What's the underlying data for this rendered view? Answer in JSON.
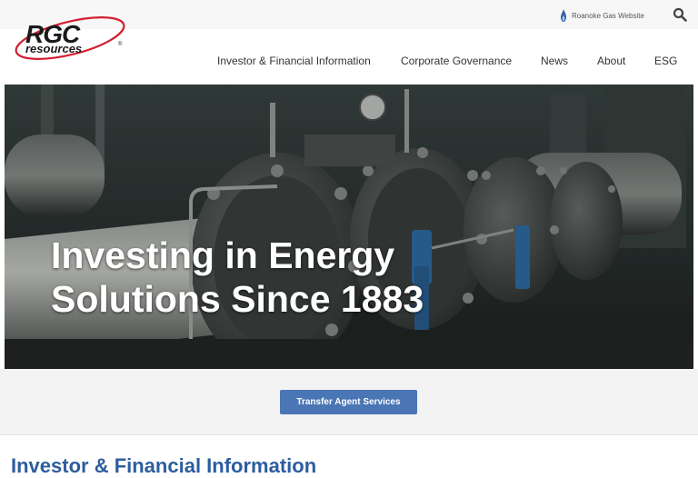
{
  "brand": {
    "logo_text_top": "RGC",
    "logo_text_bottom": "resources",
    "logo_mark": "®"
  },
  "utility": {
    "gas_link_label": "Roanoke Gas Website",
    "gas_link_icon": "flame-icon",
    "search_icon": "search-icon"
  },
  "nav": {
    "items": [
      {
        "label": "Investor & Financial Information"
      },
      {
        "label": "Corporate Governance"
      },
      {
        "label": "News"
      },
      {
        "label": "About"
      },
      {
        "label": "ESG"
      }
    ]
  },
  "hero": {
    "title": "Investing in Energy Solutions Since 1883"
  },
  "cta": {
    "label": "Transfer Agent Services"
  },
  "section": {
    "heading": "Investor & Financial Information"
  },
  "colors": {
    "accent_blue": "#4a76b5",
    "heading_blue": "#2d5d9e",
    "logo_red": "#d3202f"
  }
}
